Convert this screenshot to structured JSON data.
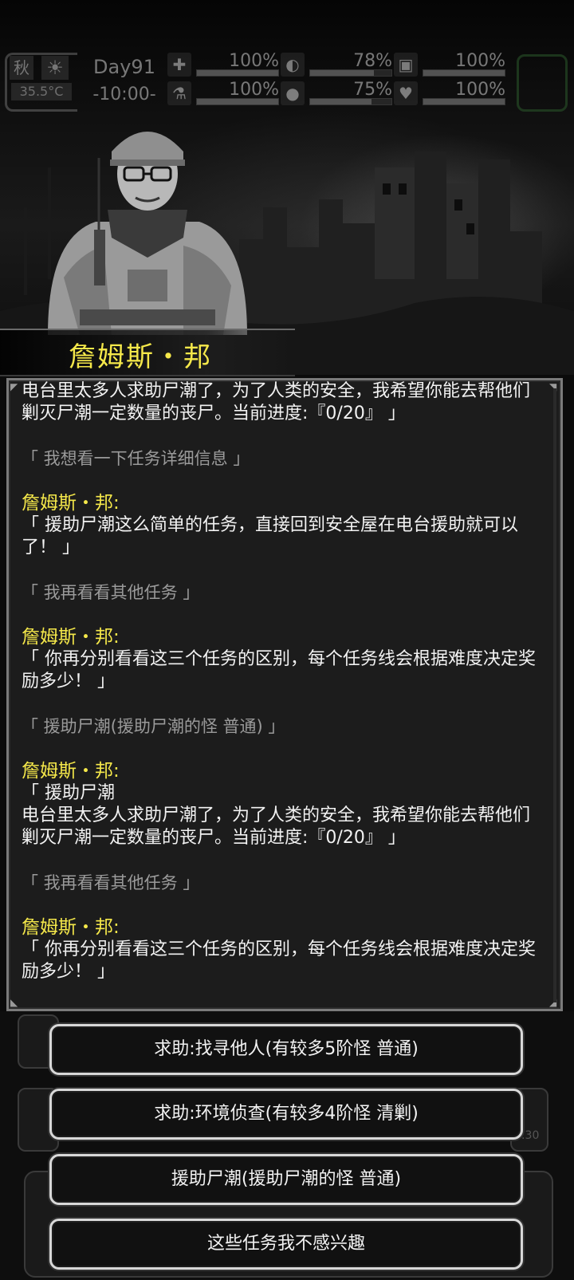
{
  "status": {
    "season": "秋",
    "weather_icon": "sun-icon",
    "temperature": "35.5°C",
    "day": "Day91",
    "time": "-10:00-",
    "stats": [
      {
        "icon": "medkit-icon",
        "glyph": "✚",
        "value": "100%",
        "level": 1.0
      },
      {
        "icon": "stomach-icon",
        "glyph": "◐",
        "value": "78%",
        "level": 0.78
      },
      {
        "icon": "shield-icon",
        "glyph": "▣",
        "value": "100%",
        "level": 1.0
      },
      {
        "icon": "flask-icon",
        "glyph": "⚗",
        "value": "100%",
        "level": 1.0
      },
      {
        "icon": "water-drop-icon",
        "glyph": "●",
        "value": "75%",
        "level": 0.75
      },
      {
        "icon": "heart-icon",
        "glyph": "♥",
        "value": "100%",
        "level": 1.0
      }
    ]
  },
  "npc": {
    "name": "詹姆斯・邦"
  },
  "dialog": {
    "intro": "电台里太多人求助尸潮了，为了人类的安全，我希望你能去帮他们剿灭尸潮一定数量的丧尸。当前进度:『0/20』 」",
    "entries": [
      {
        "choice": "「 我想看一下任务详细信息 」",
        "speaker": "詹姆斯・邦:",
        "reply": "「 援助尸潮这么简单的任务，直接回到安全屋在电台援助就可以了！ 」"
      },
      {
        "choice": "「 我再看看其他任务 」",
        "speaker": "詹姆斯・邦:",
        "reply": "「 你再分别看看这三个任务的区别，每个任务线会根据难度决定奖励多少！ 」"
      },
      {
        "choice": "「 援助尸潮(援助尸潮的怪  普通) 」",
        "speaker": "詹姆斯・邦:",
        "reply": "「 援助尸潮\n电台里太多人求助尸潮了，为了人类的安全，我希望你能去帮他们剿灭尸潮一定数量的丧尸。当前进度:『0/20』 」"
      },
      {
        "choice": "「 我再看看其他任务 」",
        "speaker": "詹姆斯・邦:",
        "reply": "「 你再分别看看这三个任务的区别，每个任务线会根据难度决定奖励多少！ 」"
      }
    ]
  },
  "options": [
    "求助:找寻他人(有较多5阶怪  普通)",
    "求助:环境侦查(有较多4阶怪  清剿)",
    "援助尸潮(援助尸潮的怪  普通)",
    "这些任务我不感兴趣"
  ],
  "background_timer": "00:30"
}
